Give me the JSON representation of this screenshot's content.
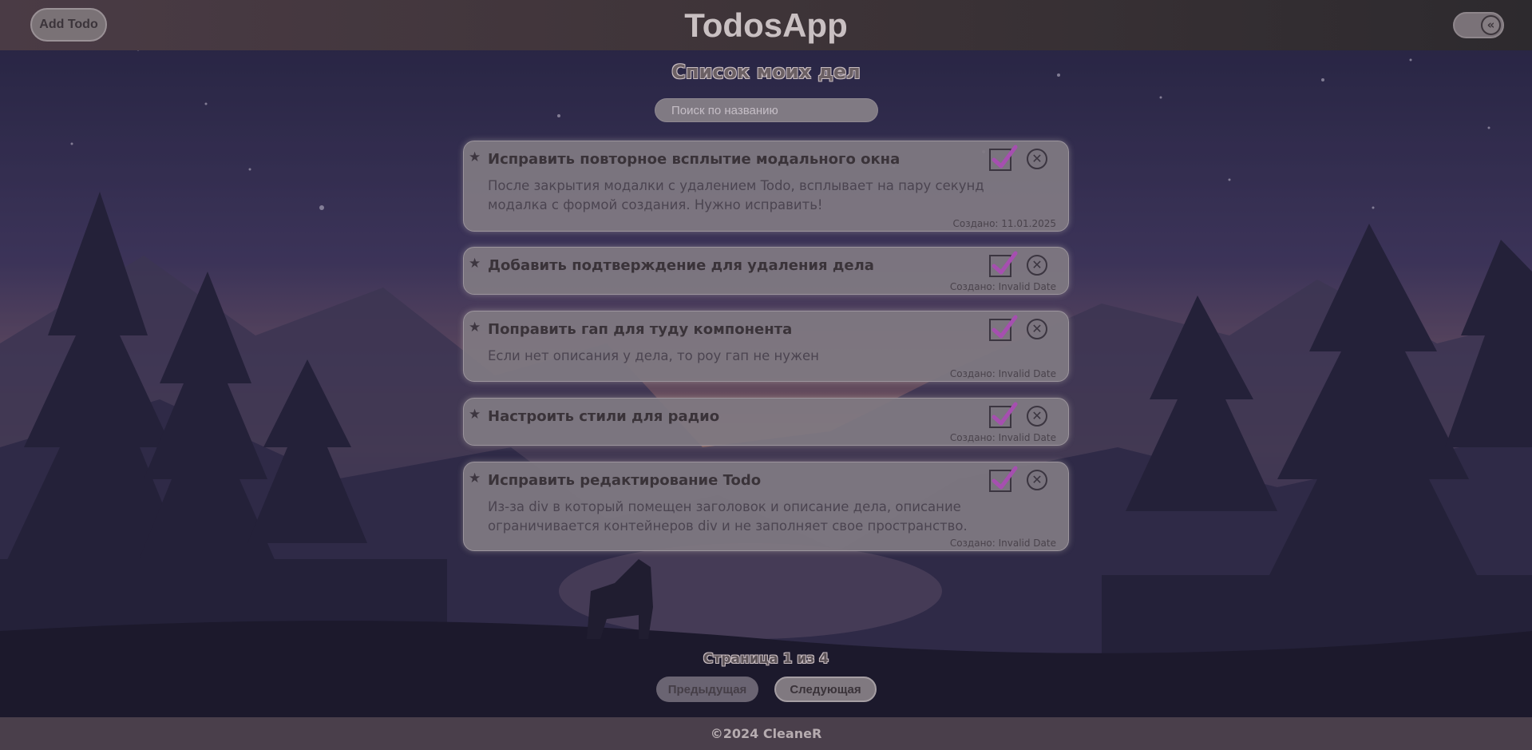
{
  "header": {
    "add_button": "Add Todo",
    "app_title": "TodosApp",
    "toggle_icon": "«"
  },
  "main": {
    "list_title": "Список моих дел",
    "search_placeholder": "Поиск по названию",
    "todos": [
      {
        "title": "Исправить повторное всплытие модального окна",
        "description": "После закрытия модалки с удалением Todo, всплывает на пару секунд модалка с формой создания. Нужно исправить!",
        "created": "Создано: 11.01.2025",
        "done": true
      },
      {
        "title": "Добавить подтверждение для удаления дела",
        "description": "",
        "created": "Создано: Invalid Date",
        "done": true
      },
      {
        "title": "Поправить гап для туду компонента",
        "description": "Если нет описания у дела, то роу гап не нужен",
        "created": "Создано: Invalid Date",
        "done": true
      },
      {
        "title": "Настроить стили для радио",
        "description": "",
        "created": "Создано: Invalid Date",
        "done": true
      },
      {
        "title": "Исправить редактирование Todo",
        "description": "Из-за div в который помещен заголовок и описание дела, описание ограничивается контейнеров div и не заполняет свое пространство.",
        "created": "Создано: Invalid Date",
        "done": true
      }
    ]
  },
  "pagination": {
    "label": "Страница 1 из 4",
    "prev": "Предыдущая",
    "next": "Следующая"
  },
  "footer": {
    "text": "©2024 CleaneR"
  },
  "colors": {
    "check_mark": "#a64fb0",
    "card_bg": "#807a82"
  }
}
